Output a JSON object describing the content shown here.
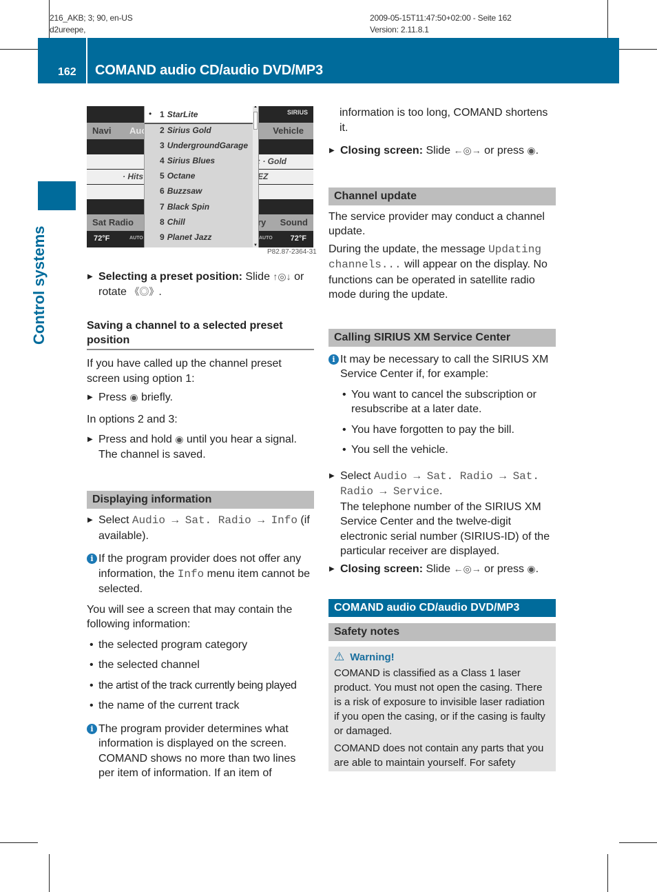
{
  "meta": {
    "left_line1": "216_AKB; 3; 90, en-US",
    "left_line2": "d2ureepe,",
    "right_line1": "2009-05-15T11:47:50+02:00 - Seite 162",
    "right_line2": "Version: 2.11.8.1"
  },
  "header": {
    "page_number": "162",
    "title": "COMAND audio CD/audio DVD/MP3",
    "accent_color": "#006b9b"
  },
  "sidebar": {
    "label": "Control systems"
  },
  "screen_image": {
    "figure_id": "P82.87-2364-31",
    "left_panel": {
      "top_label": "Navi",
      "tab_partial": "Auc",
      "row_text": "· Hits",
      "bottom_label": "Sat Radio",
      "temp": "72°F",
      "auto": "AUTO"
    },
    "right_panel": {
      "signal": "SIRIUS",
      "top_label": "Vehicle",
      "row1": ": · Gold",
      "row2": "EZ",
      "bottom_partial": "ry",
      "bottom_label": "Sound",
      "temp": "72°F",
      "auto": "AUTO"
    },
    "presets": [
      {
        "num": "1",
        "name": "StarLite",
        "selected": true
      },
      {
        "num": "2",
        "name": "Sirius Gold"
      },
      {
        "num": "3",
        "name": "UndergroundGarage"
      },
      {
        "num": "4",
        "name": "Sirius Blues"
      },
      {
        "num": "5",
        "name": "Octane"
      },
      {
        "num": "6",
        "name": "Buzzsaw"
      },
      {
        "num": "7",
        "name": "Black Spin"
      },
      {
        "num": "8",
        "name": "Chill"
      },
      {
        "num": "9",
        "name": "Planet Jazz"
      }
    ]
  },
  "left_col": {
    "step_select_preset": {
      "bold": "Selecting a preset position:",
      "text1": " Slide ",
      "text2": " or rotate ",
      "text3": "."
    },
    "saving_heading": "Saving a channel to a selected preset position",
    "saving_intro": "If you have called up the channel preset screen using option 1:",
    "step_press": {
      "text1": "Press ",
      "text2": " briefly."
    },
    "options_23": "In options 2 and 3:",
    "step_press_hold": {
      "text1": "Press and hold ",
      "text2": " until you hear a signal.",
      "text3": "The channel is saved."
    },
    "displaying_heading": "Displaying information",
    "step_select_info": {
      "text1": "Select ",
      "m1": "Audio",
      "arrow": " → ",
      "m2": "Sat. Radio",
      "m3": "Info",
      "text2": " (if available)."
    },
    "info_note1": {
      "text1": "If the program provider does not offer any information, the ",
      "mono": "Info",
      "text2": " menu item cannot be selected."
    },
    "screen_intro": "You will see a screen that may contain the following information:",
    "bullets": [
      "the selected program category",
      "the selected channel",
      "the artist of the track currently being played",
      "the name of the current track"
    ],
    "info_note2": "The program provider determines what information is displayed on the screen. COMAND shows no more than two lines per item of information. If an item of"
  },
  "right_col": {
    "continued": "information is too long, COMAND shortens it.",
    "step_close1": {
      "bold": "Closing screen:",
      "text1": " Slide ",
      "text2": " or press ",
      "text3": "."
    },
    "channel_update_heading": "Channel update",
    "cu_p1": "The service provider may conduct a channel update.",
    "cu_p2": {
      "text1": "During the update, the message ",
      "mono": "Updating channels...",
      "text2": " will appear on the display. No functions can be operated in satellite radio mode during the update."
    },
    "calling_heading": "Calling SIRIUS XM Service Center",
    "calling_info": "It may be necessary to call the SIRIUS XM Service Center if, for example:",
    "calling_bullets": [
      "You want to cancel the subscription or resubscribe at a later date.",
      "You have forgotten to pay the bill.",
      "You sell the vehicle."
    ],
    "step_select_service": {
      "text1": "Select ",
      "m1": "Audio",
      "arrow": " → ",
      "m2": "Sat. Radio",
      "m3": "Sat. Radio",
      "m4": "Service",
      "text2": ".",
      "result": "The telephone number of the SIRIUS XM Service Center and the twelve-digit electronic serial number (SIRIUS-ID) of the particular receiver are displayed."
    },
    "step_close2": {
      "bold": "Closing screen:",
      "text1": " Slide ",
      "text2": " or press ",
      "text3": "."
    },
    "comand_heading": "COMAND audio CD/audio DVD/MP3",
    "safety_heading": "Safety notes",
    "warning": {
      "title": "Warning!",
      "p1": "COMAND is classified as a Class 1 laser product. You must not open the casing. There is a risk of exposure to invisible laser radiation if you open the casing, or if the casing is faulty or damaged.",
      "p2": "COMAND does not contain any parts that you are able to maintain yourself. For safety"
    }
  },
  "icons": {
    "slide_up_down": "↑◎↓",
    "rotate": "《◎》",
    "press_knob": "press-controller-icon",
    "slide_left_right": "←◎→",
    "info": "i",
    "warning": "⚠"
  }
}
